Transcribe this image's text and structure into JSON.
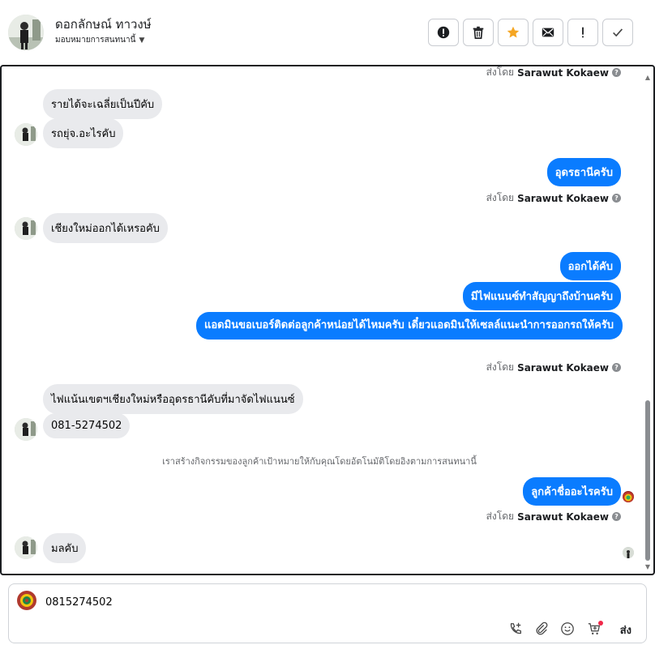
{
  "header": {
    "contact_name": "ดอกลักษณ์ ทาวงษ์",
    "assign_label": "มอบหมายการสนทนานี้",
    "actions": [
      {
        "name": "report-button",
        "icon": "exclamation-circle-icon"
      },
      {
        "name": "delete-button",
        "icon": "trash-icon"
      },
      {
        "name": "star-button",
        "icon": "star-icon",
        "color": "#f5a623"
      },
      {
        "name": "mark-unread-button",
        "icon": "envelope-icon"
      },
      {
        "name": "important-button",
        "icon": "exclamation-icon"
      },
      {
        "name": "done-button",
        "icon": "check-icon"
      }
    ]
  },
  "chat": {
    "sender_prefix": "ส่งโดย",
    "sender_name": "Sarawut Kokaew",
    "incoming_1": "รายได้จะเฉลี่ยเป็นปีคับ",
    "incoming_2": "รถยุ่จ.อะไรคับ",
    "outgoing_1": "อุดรธานีครับ",
    "incoming_3": "เชียงใหม่ออกได้เหรอคับ",
    "outgoing_2": "ออกได้คับ",
    "outgoing_3": "มีไฟแนนซ์ทำสัญญาถึงบ้านครับ",
    "outgoing_4": "แอดมินขอเบอร์ติดต่อลูกค้าหน่อยได้ไหมครับ เดี๋ยวแอดมินให้เซลล์แนะนำการออกรถให้ครับ",
    "incoming_4": "ไฟแน้นเขตฯเชียงใหม่หรืออุดรธานีคับที่มาจัดไฟแนนซ์",
    "incoming_5": "081-5274502",
    "system_note": "เราสร้างกิจกรรมของลูกค้าเป้าหมายให้กับคุณโดยอัตโนมัติโดยอิงตามการสนทนานี้",
    "outgoing_5": "ลูกค้าชื่ออะไรครับ",
    "incoming_6": "มลคับ",
    "accent_color": "#0a7cff",
    "incoming_bubble_color": "#e9eaed"
  },
  "composer": {
    "input_value": "0815274502",
    "send_label": "ส่ง",
    "tools": [
      "phone-add-icon",
      "paperclip-icon",
      "emoji-icon",
      "cart-add-icon"
    ]
  }
}
